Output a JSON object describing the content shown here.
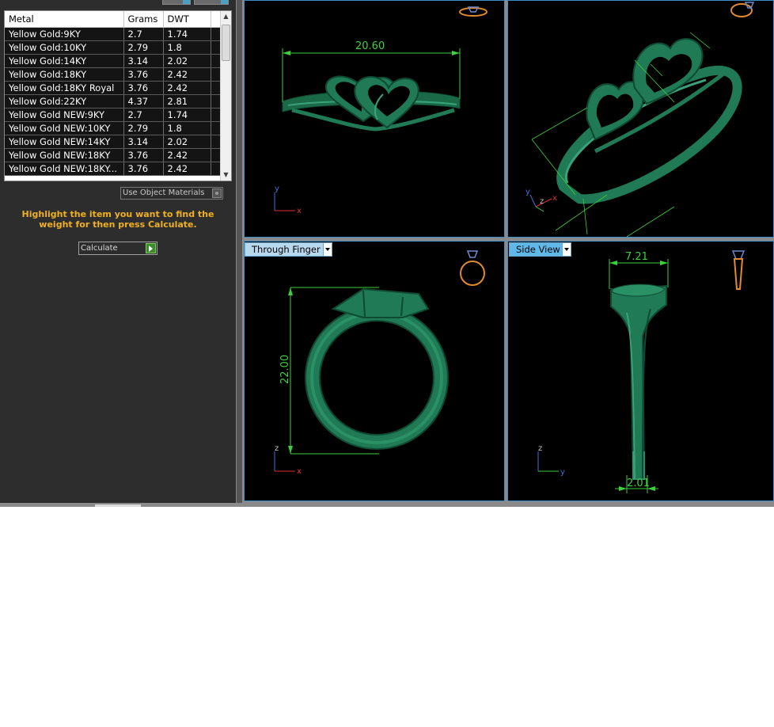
{
  "metal_table": {
    "columns": [
      "Metal",
      "Grams",
      "DWT"
    ],
    "rows": [
      [
        "Yellow Gold:9KY",
        "2.7",
        "1.74"
      ],
      [
        "Yellow Gold:10KY",
        "2.79",
        "1.8"
      ],
      [
        "Yellow Gold:14KY",
        "3.14",
        "2.02"
      ],
      [
        "Yellow Gold:18KY",
        "3.76",
        "2.42"
      ],
      [
        "Yellow Gold:18KY Royal",
        "3.76",
        "2.42"
      ],
      [
        "Yellow Gold:22KY",
        "4.37",
        "2.81"
      ],
      [
        "Yellow Gold NEW:9KY",
        "2.7",
        "1.74"
      ],
      [
        "Yellow Gold NEW:10KY",
        "2.79",
        "1.8"
      ],
      [
        "Yellow Gold NEW:14KY",
        "3.14",
        "2.02"
      ],
      [
        "Yellow Gold NEW:18KY",
        "3.76",
        "2.42"
      ],
      [
        "Yellow Gold NEW:18KY...",
        "3.76",
        "2.42"
      ]
    ]
  },
  "use_object_materials_label": "Use Object Materials",
  "instruction": "Highlight the item you want to find the weight for then press Calculate.",
  "calculate_label": "Calculate",
  "viewports": {
    "front": {
      "dimension": "20.60",
      "axis_v": "y",
      "axis_h": "x"
    },
    "perspective": {
      "axis_v": "y",
      "axis_h": "x",
      "axis_d": "z"
    },
    "through_finger": {
      "label": "Through Finger",
      "dimension": "22.00",
      "axis_v": "z",
      "axis_h": "x"
    },
    "side_view": {
      "label": "Side View",
      "dimension_top": "7.21",
      "dimension_bottom": "2.01",
      "axis_v": "z",
      "axis_h": "y"
    }
  },
  "colors": {
    "ring": "#1f7a55",
    "ring_dark": "#0f4a32",
    "dimension": "#3cd03c",
    "axis_x": "#e03030",
    "axis_y": "#4070e0",
    "viewport_border": "#3c8fc8",
    "instruction": "#f0b020"
  }
}
